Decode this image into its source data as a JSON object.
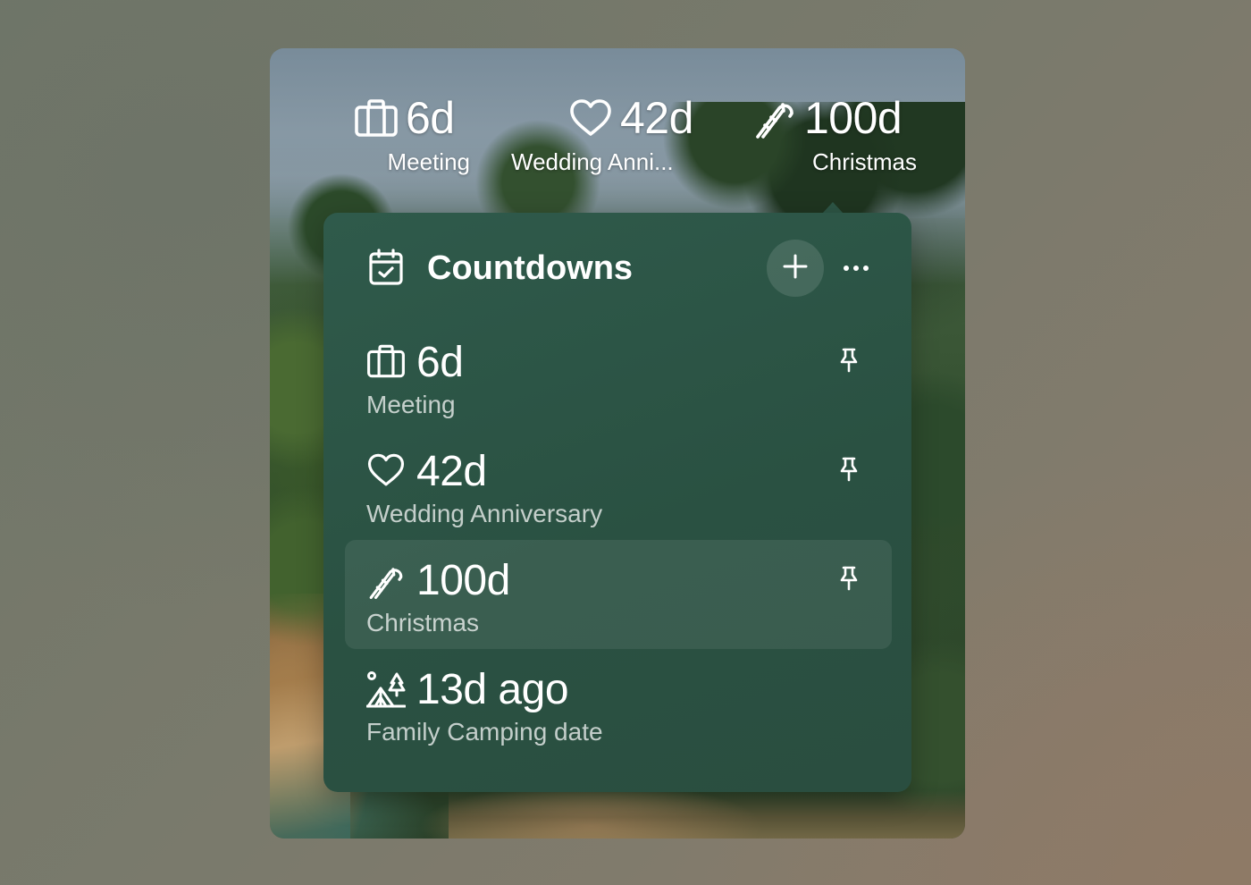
{
  "topbar": {
    "items": [
      {
        "icon": "briefcase-icon",
        "value": "6d",
        "label": "Meeting"
      },
      {
        "icon": "heart-icon",
        "value": "42d",
        "label": "Wedding Anni..."
      },
      {
        "icon": "candy-cane-icon",
        "value": "100d",
        "label": "Christmas"
      }
    ]
  },
  "panel": {
    "title": "Countdowns",
    "header_icon": "calendar-check-icon",
    "add_icon": "plus-icon",
    "more_icon": "ellipsis-icon"
  },
  "countdowns": [
    {
      "icon": "briefcase-icon",
      "value": "6d",
      "label": "Meeting",
      "pinned_icon": "pin-icon",
      "highlighted": false
    },
    {
      "icon": "heart-icon",
      "value": "42d",
      "label": "Wedding Anniversary",
      "pinned_icon": "pin-icon",
      "highlighted": false
    },
    {
      "icon": "candy-cane-icon",
      "value": "100d",
      "label": "Christmas",
      "pinned_icon": "pin-icon",
      "highlighted": true
    },
    {
      "icon": "camping-icon",
      "value": "13d ago",
      "label": "Family Camping date",
      "highlighted": false
    }
  ],
  "colors": {
    "panel_bg": "#2b5344",
    "highlight_row": "rgba(255,255,255,0.08)",
    "text_primary": "#ffffff",
    "text_secondary": "rgba(255,255,255,0.72)"
  }
}
